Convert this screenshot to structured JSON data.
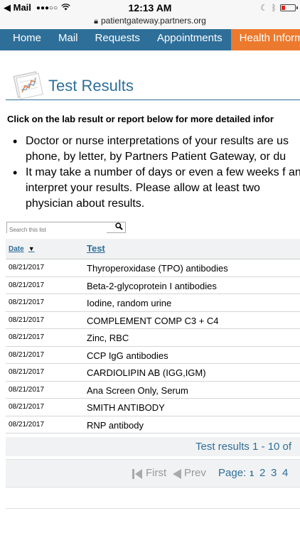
{
  "status_bar": {
    "back_app": "Mail",
    "signal": "●●●○○",
    "time": "12:13 AM"
  },
  "url_bar": {
    "url": "patientgateway.partners.org"
  },
  "nav": {
    "items": [
      {
        "label": "Home"
      },
      {
        "label": "Mail"
      },
      {
        "label": "Requests"
      },
      {
        "label": "Appointments"
      },
      {
        "label": "Health Informa"
      }
    ]
  },
  "page": {
    "title": "Test Results",
    "intro": "Click on the lab result or report below for more detailed infor",
    "bullets": [
      "Doctor or nurse interpretations of your results are us phone, by letter, by Partners Patient Gateway, or du",
      "It may take a number of days or even a few weeks f and interpret your results. Please allow at least two physician about results."
    ]
  },
  "search": {
    "placeholder": "Search this list"
  },
  "table": {
    "columns": {
      "date": "Date",
      "sort_indicator": "▼",
      "test": "Test"
    },
    "rows": [
      {
        "date": "08/21/2017",
        "test": "Thyroperoxidase (TPO) antibodies"
      },
      {
        "date": "08/21/2017",
        "test": "Beta-2-glycoprotein I antibodies"
      },
      {
        "date": "08/21/2017",
        "test": "Iodine, random urine"
      },
      {
        "date": "08/21/2017",
        "test": "COMPLEMENT COMP C3 + C4"
      },
      {
        "date": "08/21/2017",
        "test": "Zinc, RBC"
      },
      {
        "date": "08/21/2017",
        "test": "CCP IgG antibodies"
      },
      {
        "date": "08/21/2017",
        "test": "CARDIOLIPIN AB (IGG,IGM)"
      },
      {
        "date": "08/21/2017",
        "test": "Ana Screen Only, Serum"
      },
      {
        "date": "08/21/2017",
        "test": "SMITH ANTIBODY"
      },
      {
        "date": "08/21/2017",
        "test": "RNP antibody"
      }
    ]
  },
  "summary": "Test results 1 - 10 of",
  "pager": {
    "first": "First",
    "prev": "Prev",
    "page_label": "Page:",
    "pages": [
      "1",
      "2",
      "3",
      "4"
    ],
    "current": "1"
  },
  "colors": {
    "nav_blue": "#2e6f99",
    "nav_active_orange": "#ec7a2e",
    "link_blue": "#2e6f99"
  }
}
